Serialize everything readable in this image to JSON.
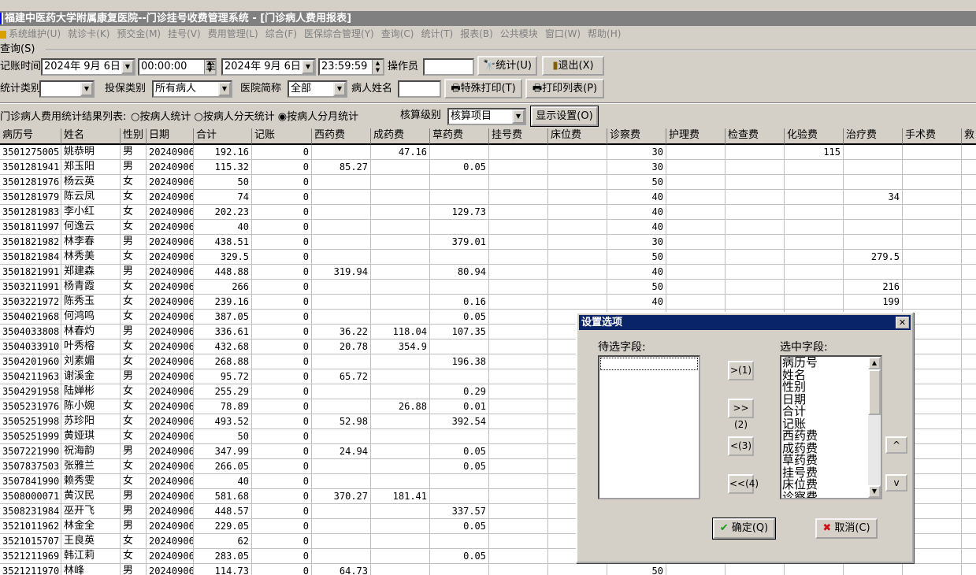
{
  "window": {
    "title": "福建中医药大学附属康复医院--门诊挂号收费管理系统 - [门诊病人费用报表]"
  },
  "menu": [
    "系统维护(U)",
    "就诊卡(K)",
    "预交金(M)",
    "挂号(V)",
    "费用管理(L)",
    "综合(F)",
    "医保综合管理(Y)",
    "查询(C)",
    "统计(T)",
    "报表(B)",
    "公共模块",
    "窗口(W)",
    "帮助(H)"
  ],
  "query": {
    "group_label": "查询(S)",
    "time_label": "记账时间",
    "start_date": "2024年 9月 6日",
    "start_time": "00:00:00",
    "to_label": "至",
    "end_date": "2024年 9月 6日",
    "end_time": "23:59:59",
    "operator_label": "操作员",
    "operator_value": "",
    "stat_button": "统计(U)",
    "exit_button": "退出(X)",
    "stat_type_label": "统计类别",
    "stat_type_value": "",
    "insure_label": "投保类别",
    "insure_value": "所有病人",
    "hospital_label": "医院简称",
    "hospital_value": "全部",
    "patient_label": "病人姓名",
    "patient_value": "",
    "special_print_button": "特殊打印(T)",
    "print_list_button": "打印列表(P)"
  },
  "results": {
    "label": "门诊病人费用统计结果列表:",
    "radios": [
      {
        "label": "按病人统计",
        "checked": false
      },
      {
        "label": "按病人分天统计",
        "checked": false
      },
      {
        "label": "按病人分月统计",
        "checked": true
      }
    ],
    "level_label": "核算级别",
    "level_value": "核算项目",
    "display_settings_button": "显示设置(O)"
  },
  "table": {
    "columns": [
      "病历号",
      "姓名",
      "性别",
      "日期",
      "合计",
      "记账",
      "西药费",
      "成药费",
      "草药费",
      "挂号费",
      "床位费",
      "诊察费",
      "护理费",
      "检查费",
      "化验费",
      "治疗费",
      "手术费",
      "救"
    ],
    "rows": [
      [
        "3501275005",
        "姚恭明",
        "男",
        "20240906",
        "192.16",
        "0",
        "",
        "47.16",
        "",
        "",
        "",
        "30",
        "",
        "",
        "115",
        "",
        ""
      ],
      [
        "3501281941",
        "郑玉阳",
        "男",
        "20240906",
        "115.32",
        "0",
        "85.27",
        "",
        "0.05",
        "",
        "",
        "30",
        "",
        "",
        "",
        "",
        ""
      ],
      [
        "3501281976",
        "杨云英",
        "女",
        "20240906",
        "50",
        "0",
        "",
        "",
        "",
        "",
        "",
        "50",
        "",
        "",
        "",
        "",
        ""
      ],
      [
        "3501281979",
        "陈云凤",
        "女",
        "20240906",
        "74",
        "0",
        "",
        "",
        "",
        "",
        "",
        "40",
        "",
        "",
        "",
        "34",
        ""
      ],
      [
        "3501281983",
        "李小红",
        "女",
        "20240906",
        "202.23",
        "0",
        "",
        "",
        "129.73",
        "",
        "",
        "40",
        "",
        "",
        "",
        "",
        ""
      ],
      [
        "3501811997",
        "何逸云",
        "女",
        "20240906",
        "40",
        "0",
        "",
        "",
        "",
        "",
        "",
        "40",
        "",
        "",
        "",
        "",
        ""
      ],
      [
        "3501821982",
        "林李春",
        "男",
        "20240906",
        "438.51",
        "0",
        "",
        "",
        "379.01",
        "",
        "",
        "30",
        "",
        "",
        "",
        "",
        ""
      ],
      [
        "3501821984",
        "林秀美",
        "女",
        "20240906",
        "329.5",
        "0",
        "",
        "",
        "",
        "",
        "",
        "50",
        "",
        "",
        "",
        "279.5",
        ""
      ],
      [
        "3501821991",
        "郑建森",
        "男",
        "20240906",
        "448.88",
        "0",
        "319.94",
        "",
        "80.94",
        "",
        "",
        "40",
        "",
        "",
        "",
        "",
        ""
      ],
      [
        "3503211991",
        "杨青霞",
        "女",
        "20240906",
        "266",
        "0",
        "",
        "",
        "",
        "",
        "",
        "50",
        "",
        "",
        "",
        "216",
        ""
      ],
      [
        "3503221972",
        "陈秀玉",
        "女",
        "20240906",
        "239.16",
        "0",
        "",
        "",
        "0.16",
        "",
        "",
        "40",
        "",
        "",
        "",
        "199",
        ""
      ],
      [
        "3504021968",
        "何鸿鸣",
        "女",
        "20240906",
        "387.05",
        "0",
        "",
        "",
        "0.05",
        "",
        "",
        "",
        "",
        "",
        "",
        "",
        ""
      ],
      [
        "3504033808",
        "林春灼",
        "男",
        "20240906",
        "336.61",
        "0",
        "36.22",
        "118.04",
        "107.35",
        "",
        "",
        "",
        "",
        "",
        "",
        "",
        ""
      ],
      [
        "3504033910",
        "叶秀榕",
        "女",
        "20240906",
        "432.68",
        "0",
        "20.78",
        "354.9",
        "",
        "",
        "",
        "",
        "",
        "",
        "",
        "",
        ""
      ],
      [
        "3504201960",
        "刘素媚",
        "女",
        "20240906",
        "268.88",
        "0",
        "",
        "",
        "196.38",
        "",
        "",
        "",
        "",
        "",
        "",
        "",
        ""
      ],
      [
        "3504211963",
        "谢溪金",
        "男",
        "20240906",
        "95.72",
        "0",
        "65.72",
        "",
        "",
        "",
        "",
        "",
        "",
        "",
        "",
        "",
        ""
      ],
      [
        "3504291958",
        "陆婵彬",
        "女",
        "20240906",
        "255.29",
        "0",
        "",
        "",
        "0.29",
        "",
        "",
        "",
        "",
        "",
        "",
        "",
        ""
      ],
      [
        "3505231976",
        "陈小婉",
        "女",
        "20240906",
        "78.89",
        "0",
        "",
        "26.88",
        "0.01",
        "",
        "",
        "",
        "",
        "",
        "",
        "",
        ""
      ],
      [
        "3505251998",
        "苏珍阳",
        "女",
        "20240906",
        "493.52",
        "0",
        "52.98",
        "",
        "392.54",
        "",
        "",
        "",
        "",
        "",
        "",
        "",
        ""
      ],
      [
        "3505251999",
        "黄娅琪",
        "女",
        "20240906",
        "50",
        "0",
        "",
        "",
        "",
        "",
        "",
        "",
        "",
        "",
        "",
        "",
        ""
      ],
      [
        "3507221990",
        "祝海韵",
        "男",
        "20240906",
        "347.99",
        "0",
        "24.94",
        "",
        "0.05",
        "",
        "",
        "",
        "",
        "",
        "",
        "",
        ""
      ],
      [
        "3507837503",
        "张雅兰",
        "女",
        "20240906",
        "266.05",
        "0",
        "",
        "",
        "0.05",
        "",
        "",
        "",
        "",
        "",
        "",
        "",
        ""
      ],
      [
        "3507841990",
        "赖秀雯",
        "女",
        "20240906",
        "40",
        "0",
        "",
        "",
        "",
        "",
        "",
        "",
        "",
        "",
        "",
        "",
        ""
      ],
      [
        "3508000071",
        "黄汉民",
        "男",
        "20240906",
        "581.68",
        "0",
        "370.27",
        "181.41",
        "",
        "",
        "",
        "",
        "",
        "",
        "",
        "",
        ""
      ],
      [
        "3508231984",
        "巫开飞",
        "男",
        "20240906",
        "448.57",
        "0",
        "",
        "",
        "337.57",
        "",
        "",
        "",
        "",
        "",
        "",
        "",
        ""
      ],
      [
        "3521011962",
        "林金全",
        "男",
        "20240906",
        "229.05",
        "0",
        "",
        "",
        "0.05",
        "",
        "",
        "",
        "",
        "",
        "",
        "",
        ""
      ],
      [
        "3521015707",
        "王良英",
        "女",
        "20240906",
        "62",
        "0",
        "",
        "",
        "",
        "",
        "",
        "",
        "",
        "",
        "",
        "",
        ""
      ],
      [
        "3521211969",
        "韩江莉",
        "女",
        "20240906",
        "283.05",
        "0",
        "",
        "",
        "0.05",
        "",
        "",
        "",
        "",
        "",
        "",
        "",
        ""
      ],
      [
        "3521211970",
        "林峰",
        "男",
        "20240906",
        "114.73",
        "0",
        "64.73",
        "",
        "",
        "",
        "",
        "50",
        "",
        "",
        "",
        "",
        ""
      ]
    ]
  },
  "dialog": {
    "title": "设置选项",
    "close": "✕",
    "available_label": "待选字段:",
    "selected_label": "选中字段:",
    "available_fields": [],
    "selected_fields": [
      "病历号",
      "姓名",
      "性别",
      "日期",
      "合计",
      "记账",
      "西药费",
      "成药费",
      "草药费",
      "挂号费",
      "床位费",
      "诊察费"
    ],
    "move_one": ">(1)",
    "move_all": ">>(2)",
    "remove_one": "<(3)",
    "remove_all": "<<(4)",
    "up": "^",
    "down": "v",
    "ok_button": "确定(Q)",
    "cancel_button": "取消(C)"
  }
}
